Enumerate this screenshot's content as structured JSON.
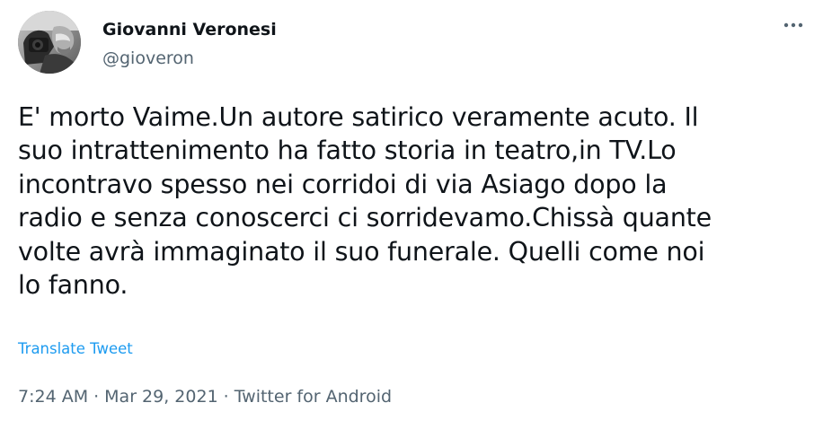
{
  "author": {
    "display_name": "Giovanni Veronesi",
    "handle": "@gioveron",
    "avatar_icon": "user-avatar-photo"
  },
  "menu": {
    "more_icon": "more-horizontal-icon"
  },
  "tweet": {
    "text": "E' morto Vaime.Un autore satirico veramente acuto. Il\nsuo intrattenimento ha fatto storia in teatro,in TV.Lo\nincontravo spesso nei corridoi di via Asiago dopo la\nradio e senza conoscerci ci sorridevamo.Chissà quante\nvolte avrà immaginato il suo funerale. Quelli come noi\nlo fanno.",
    "translate_label": "Translate Tweet"
  },
  "meta": {
    "time": "7:24 AM",
    "separator": "·",
    "date": "Mar 29, 2021",
    "source": "Twitter for Android"
  },
  "colors": {
    "text": "#0f1419",
    "secondary": "#536471",
    "link": "#1d9bf0",
    "background": "#ffffff"
  }
}
